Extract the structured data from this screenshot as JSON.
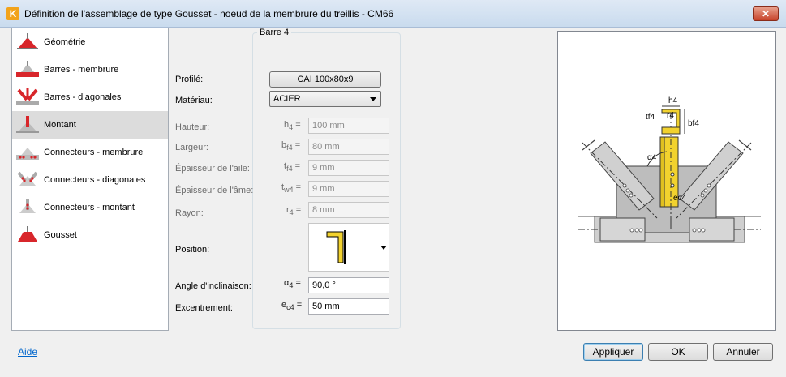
{
  "window": {
    "title": "Définition de l'assemblage de type Gousset - noeud de la membrure du treillis - CM66",
    "close_label": "✕"
  },
  "nav": {
    "items": [
      {
        "label": "Géométrie",
        "icon": "gusset-geometry-icon"
      },
      {
        "label": "Barres - membrure",
        "icon": "chord-bars-icon"
      },
      {
        "label": "Barres - diagonales",
        "icon": "diagonal-bars-icon"
      },
      {
        "label": "Montant",
        "icon": "vertical-member-icon"
      },
      {
        "label": "Connecteurs - membrure",
        "icon": "chord-connectors-icon"
      },
      {
        "label": "Connecteurs - diagonales",
        "icon": "diagonal-connectors-icon"
      },
      {
        "label": "Connecteurs - montant",
        "icon": "vertical-connectors-icon"
      },
      {
        "label": "Gousset",
        "icon": "gusset-plate-icon"
      }
    ],
    "selected": "Montant"
  },
  "form": {
    "group_title": "Barre 4",
    "labels": {
      "profile": "Profilé:",
      "material": "Matériau:",
      "height": "Hauteur:",
      "width": "Largeur:",
      "flange": "Épaisseur de l'aile:",
      "web": "Épaisseur de l'âme:",
      "radius": "Rayon:",
      "position": "Position:",
      "angle": "Angle d'inclinaison:",
      "eccentricity": "Excentrement:"
    },
    "profile_value": "CAI 100x80x9",
    "material_value": "ACIER",
    "symbols": {
      "h": "h",
      "h_sub": "4",
      "b": "b",
      "b_sub": "f4",
      "tf": "t",
      "tf_sub": "f4",
      "tw": "t",
      "tw_sub": "w4",
      "r": "r",
      "r_sub": "4",
      "alpha": "α",
      "alpha_sub": "4",
      "e": "e",
      "e_sub": "c4",
      "eq": "="
    },
    "values": {
      "height": "100 mm",
      "width": "80 mm",
      "flange": "9 mm",
      "web": "9 mm",
      "radius": "8 mm",
      "angle": "90,0 °",
      "eccentricity": "50 mm"
    }
  },
  "preview": {
    "labels": {
      "h4": "h4",
      "r4": "r4",
      "tf4": "tf4",
      "bf4": "bf4",
      "alpha4": "α4",
      "ec4": "ec4"
    }
  },
  "footer": {
    "help": "Aide",
    "apply": "Appliquer",
    "ok": "OK",
    "cancel": "Annuler"
  },
  "colors": {
    "accent_red": "#d8262b",
    "section_yellow": "#f2d22e",
    "titlebar": "#c9dbee"
  }
}
